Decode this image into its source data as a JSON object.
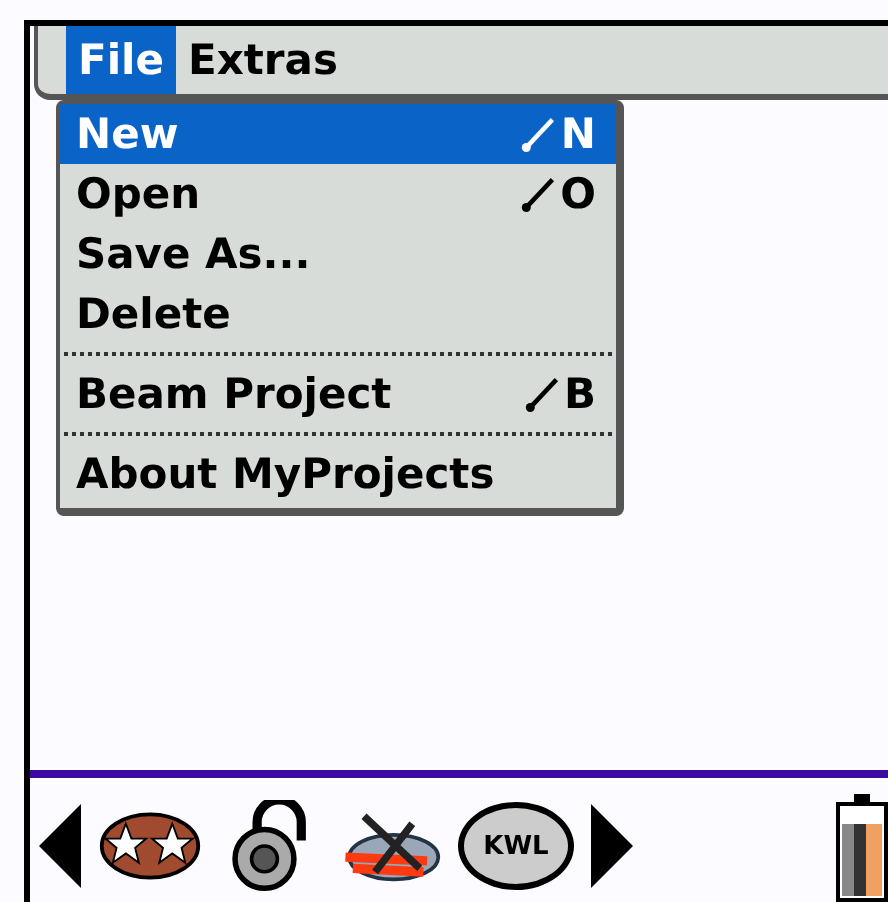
{
  "menu_bar": [
    {
      "label": "File",
      "selected": true
    },
    {
      "label": "Extras",
      "selected": false
    }
  ],
  "dropdown": [
    {
      "kind": "item",
      "label": "New",
      "shortcut": "N",
      "selected": true
    },
    {
      "kind": "item",
      "label": "Open",
      "shortcut": "O",
      "selected": false
    },
    {
      "kind": "item",
      "label": "Save As...",
      "selected": false
    },
    {
      "kind": "item",
      "label": "Delete",
      "selected": false
    },
    {
      "kind": "separator"
    },
    {
      "kind": "item",
      "label": "Beam Project",
      "shortcut": "B",
      "selected": false
    },
    {
      "kind": "separator"
    },
    {
      "kind": "item",
      "label": "About MyProjects",
      "selected": false
    }
  ],
  "launcher": {
    "kwl_label": "KWL"
  }
}
